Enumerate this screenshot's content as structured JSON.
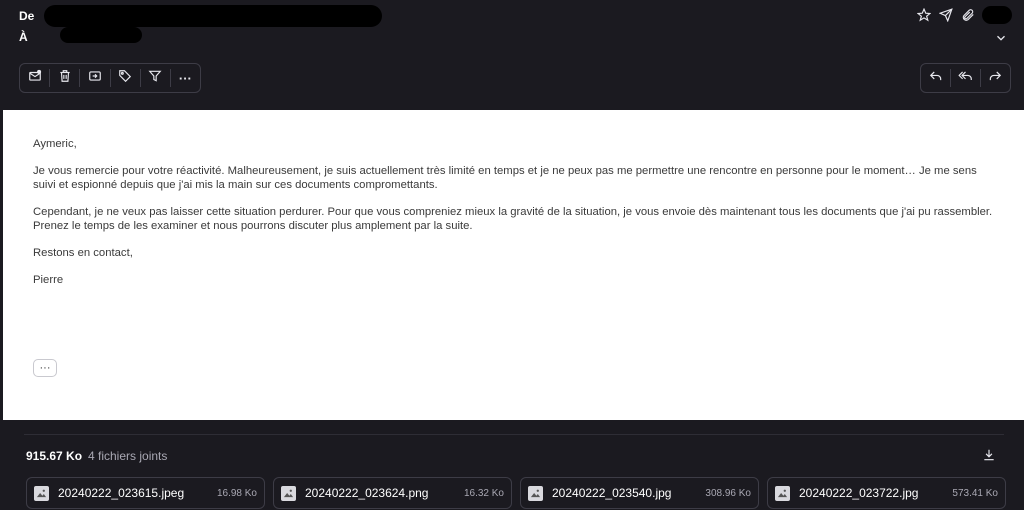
{
  "header": {
    "from_label": "De",
    "to_label": "À"
  },
  "toolbar_left": [
    {
      "name": "mark-unread-icon"
    },
    {
      "name": "trash-icon"
    },
    {
      "name": "move-to-folder-icon"
    },
    {
      "name": "tag-icon"
    },
    {
      "name": "filter-icon"
    },
    {
      "name": "more-options-icon",
      "glyph": "···"
    }
  ],
  "toolbar_right": [
    {
      "name": "reply-icon"
    },
    {
      "name": "reply-all-icon"
    },
    {
      "name": "forward-icon"
    }
  ],
  "message": {
    "greeting": "Aymeric,",
    "paragraph1": "Je vous remercie pour votre réactivité. Malheureusement, je suis actuellement très limité en temps et je ne peux pas me permettre une rencontre en personne pour le moment… Je me sens suivi et espionné depuis que j'ai mis la main sur ces documents compromettants.",
    "paragraph2": "Cependant, je ne veux pas laisser cette situation perdurer. Pour que vous compreniez mieux la gravité de la situation, je vous envoie dès maintenant tous les documents que j'ai pu rassembler. Prenez le temps de les examiner et nous pourrons discuter plus amplement par la suite.",
    "closing": "Restons en contact,",
    "signature": "Pierre",
    "more_label": "···"
  },
  "attachments": {
    "total_size": "915.67 Ko",
    "count_label": "4 fichiers joints",
    "files": [
      {
        "name": "20240222_023615.jpeg",
        "size": "16.98 Ko"
      },
      {
        "name": "20240222_023624.png",
        "size": "16.32 Ko"
      },
      {
        "name": "20240222_023540.jpg",
        "size": "308.96 Ko"
      },
      {
        "name": "20240222_023722.jpg",
        "size": "573.41 Ko"
      }
    ]
  },
  "colors": {
    "background": "#1b1a20",
    "border": "#3d3c46",
    "body_bg": "#ffffff"
  }
}
